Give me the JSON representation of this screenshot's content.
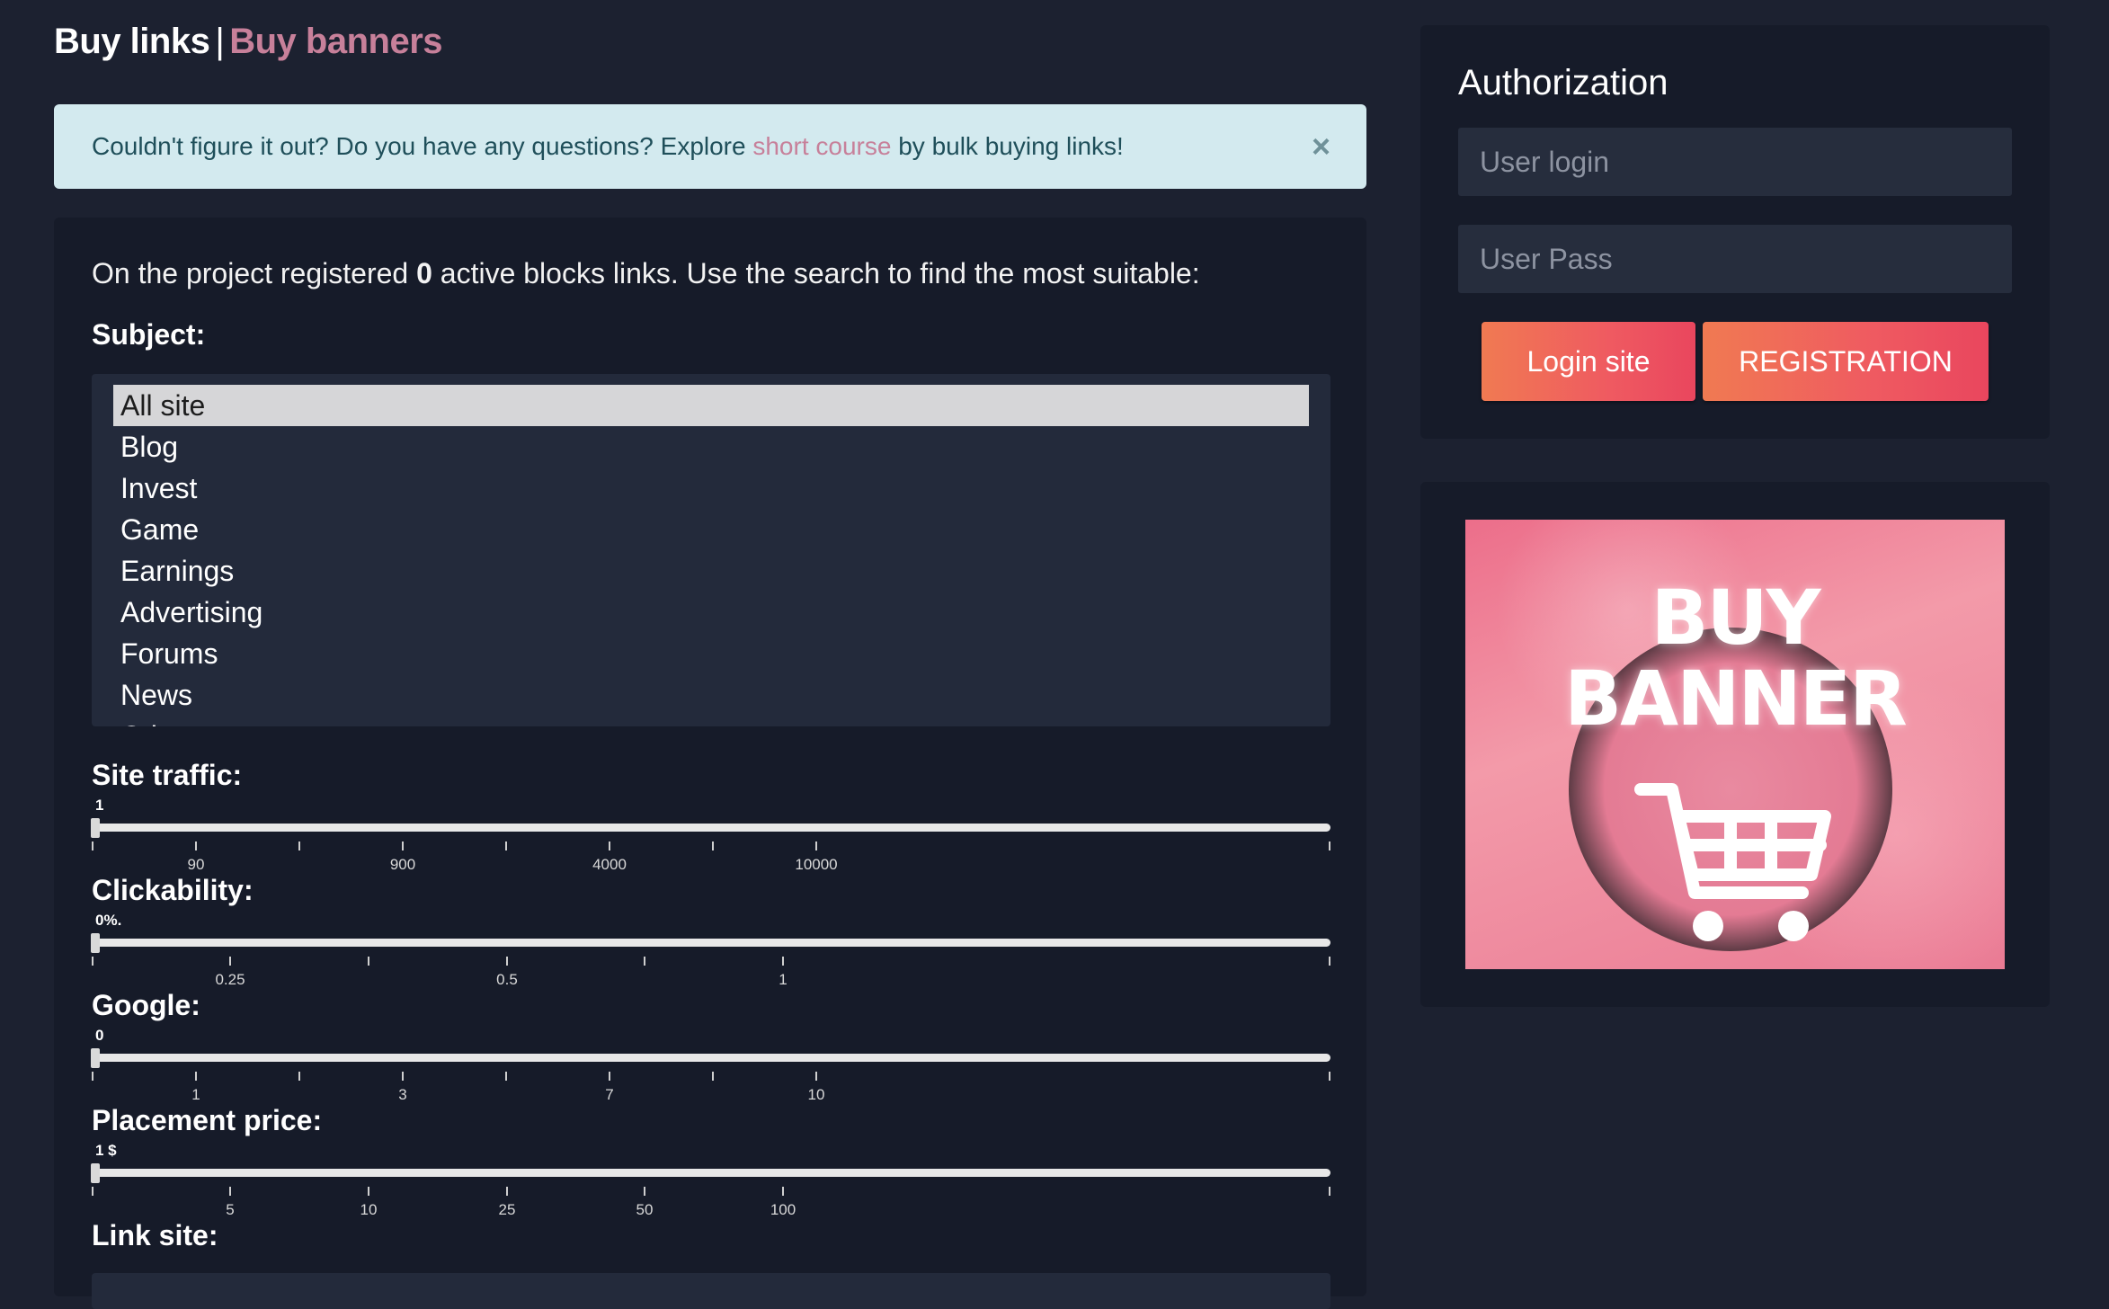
{
  "header": {
    "buy_links": "Buy links",
    "separator": "|",
    "buy_banners": "Buy banners"
  },
  "alert": {
    "text_before": "Couldn't figure it out? Do you have any questions? Explore ",
    "link": "short course",
    "text_after": " by bulk buying links!",
    "close": "×"
  },
  "intro": {
    "text_before": "On the project registered ",
    "count": "0",
    "text_after": " active blocks links. Use the search to find the most suitable:"
  },
  "subject": {
    "label": "Subject:",
    "options": [
      "All site",
      "Blog",
      "Invest",
      "Game",
      "Earnings",
      "Advertising",
      "Forums",
      "News",
      "Other"
    ],
    "selected": "All site"
  },
  "sliders": {
    "traffic": {
      "label": "Site traffic:",
      "value": "1",
      "ticks": [
        "90",
        "900",
        "4000",
        "10000"
      ]
    },
    "clickability": {
      "label": "Clickability:",
      "value": "0%.",
      "ticks": [
        "0.25",
        "0.5",
        "1"
      ]
    },
    "google": {
      "label": "Google:",
      "value": "0",
      "ticks": [
        "1",
        "3",
        "7",
        "10"
      ]
    },
    "price": {
      "label": "Placement price:",
      "value": "1 $",
      "ticks": [
        "5",
        "10",
        "25",
        "50",
        "100"
      ]
    }
  },
  "link_site": {
    "label": "Link site:"
  },
  "auth": {
    "title": "Authorization",
    "login_placeholder": "User login",
    "pass_placeholder": "User Pass",
    "login_button": "Login site",
    "register_button": "REGISTRATION"
  },
  "banner": {
    "line1": "BUY",
    "line2": "BANNER"
  },
  "colors": {
    "background": "#1c2130",
    "panel": "#161b29",
    "accent_pink": "#c7809a",
    "alert_bg": "#d3eaef",
    "button_start": "#f07a52",
    "button_end": "#e9465e"
  }
}
